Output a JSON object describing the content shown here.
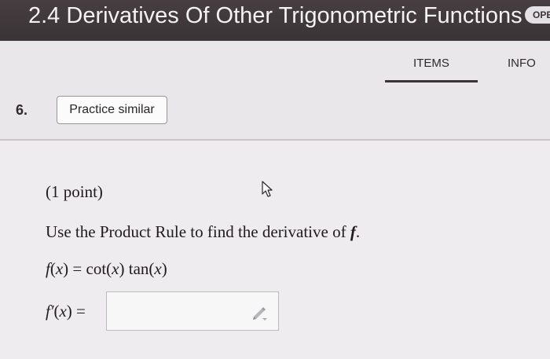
{
  "header": {
    "title": "2.4 Derivatives Of Other Trigonometric Functions",
    "open_label": "OPEN"
  },
  "tabs": [
    {
      "label": "ITEMS",
      "active": true
    },
    {
      "label": "INFO",
      "active": false
    }
  ],
  "question": {
    "number": "6.",
    "practice_label": "Practice similar",
    "points": "(1 point)",
    "instruction_prefix": "Use the Product Rule to find the derivative of ",
    "instruction_var": "f",
    "instruction_suffix": ".",
    "function": {
      "lhs_name": "f",
      "lhs_var": "x",
      "rhs_fn1": "cot",
      "rhs_fn2": "tan",
      "rhs_var": "x"
    },
    "derivative_label": {
      "name": "f′",
      "var": "x"
    },
    "answer_value": ""
  },
  "icons": {
    "pencil": "pencil-icon",
    "cursor": "mouse-cursor-icon"
  },
  "colors": {
    "header_bg": "#3b3436",
    "page_bg": "#e9e7ea",
    "accent_underline": "#3b3436"
  }
}
